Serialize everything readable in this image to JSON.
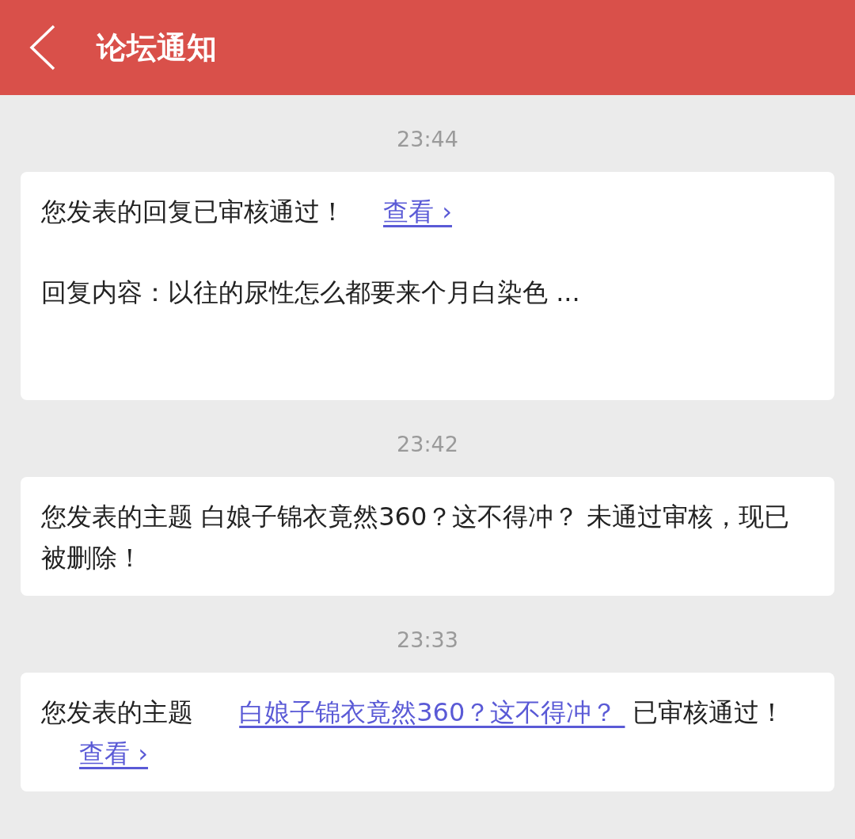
{
  "header": {
    "title": "论坛通知"
  },
  "messages": [
    {
      "time": "23:44",
      "paragraphs": [
        [
          {
            "kind": "text",
            "text": "您发表的回复已审核通过！"
          },
          {
            "kind": "link",
            "text": "查看 ›"
          }
        ],
        [
          {
            "kind": "text",
            "text": "回复内容：以往的尿性怎么都要来个月白染色 ..."
          }
        ]
      ]
    },
    {
      "time": "23:42",
      "paragraphs": [
        [
          {
            "kind": "text",
            "text": "您发表的主题 白娘子锦衣竟然360？这不得冲？ 未通过审核，现已被删除！"
          }
        ]
      ]
    },
    {
      "time": "23:33",
      "paragraphs": [
        [
          {
            "kind": "text",
            "text": "您发表的主题 "
          },
          {
            "kind": "link",
            "text": "白娘子锦衣竟然360？这不得冲？ "
          },
          {
            "kind": "text",
            "text": " 已审核通过！"
          },
          {
            "kind": "link",
            "text": "查看 ›"
          }
        ]
      ]
    }
  ]
}
